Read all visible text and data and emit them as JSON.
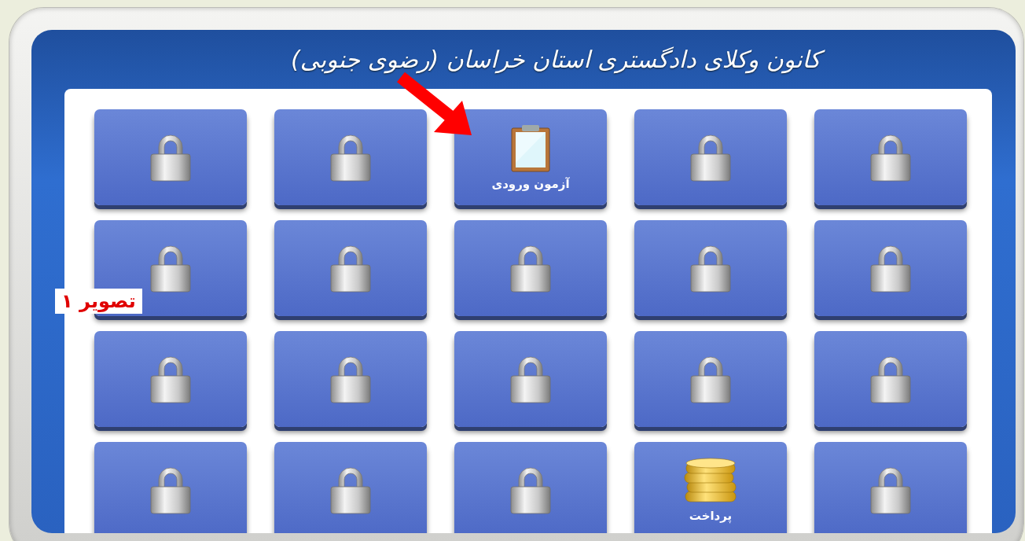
{
  "header": {
    "title": "کانون وکلای دادگستری استان خراسان (رضوی جنوبی)"
  },
  "tiles": [
    {
      "kind": "locked"
    },
    {
      "kind": "locked"
    },
    {
      "kind": "exam",
      "label": "آزمون ورودی"
    },
    {
      "kind": "locked"
    },
    {
      "kind": "locked"
    },
    {
      "kind": "locked"
    },
    {
      "kind": "locked"
    },
    {
      "kind": "locked"
    },
    {
      "kind": "locked"
    },
    {
      "kind": "locked"
    },
    {
      "kind": "locked"
    },
    {
      "kind": "locked"
    },
    {
      "kind": "locked"
    },
    {
      "kind": "locked"
    },
    {
      "kind": "locked"
    },
    {
      "kind": "locked"
    },
    {
      "kind": "payment",
      "label": "پرداخت"
    },
    {
      "kind": "locked"
    },
    {
      "kind": "locked"
    },
    {
      "kind": "locked"
    }
  ],
  "annotation": {
    "caption": "تصویر ۱"
  }
}
